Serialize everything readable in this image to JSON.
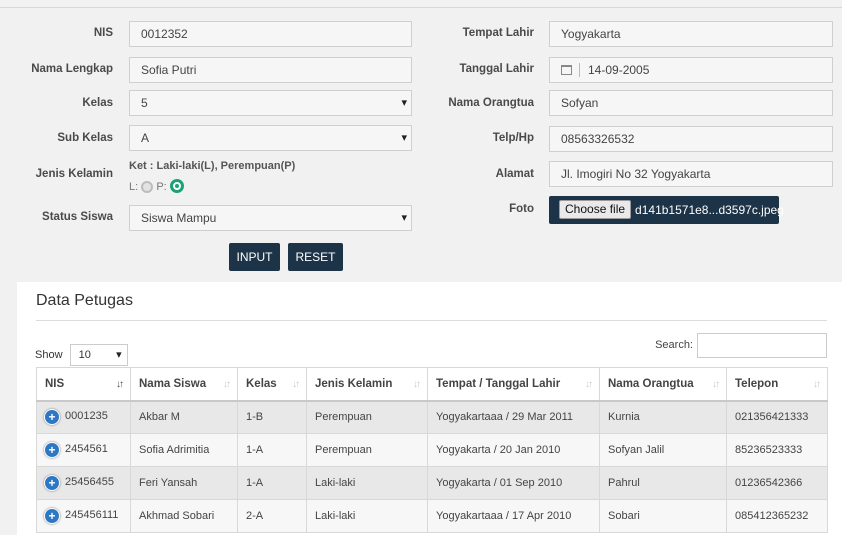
{
  "form": {
    "nis": {
      "label": "NIS",
      "value": "0012352"
    },
    "nama": {
      "label": "Nama Lengkap",
      "value": "Sofia Putri"
    },
    "kelas": {
      "label": "Kelas",
      "value": "5"
    },
    "subkelas": {
      "label": "Sub Kelas",
      "value": "A"
    },
    "jenis": {
      "label": "Jenis Kelamin",
      "note": "Ket : Laki-laki(L), Perempuan(P)",
      "opt_l": "L:",
      "opt_p": "P:",
      "selected": "P"
    },
    "status": {
      "label": "Status Siswa",
      "value": "Siswa Mampu"
    },
    "tempat": {
      "label": "Tempat Lahir",
      "value": "Yogyakarta"
    },
    "tanggal": {
      "label": "Tanggal Lahir",
      "value": "14-09-2005"
    },
    "orangtua": {
      "label": "Nama Orangtua",
      "value": "Sofyan"
    },
    "telp": {
      "label": "Telp/Hp",
      "value": "08563326532"
    },
    "alamat": {
      "label": "Alamat",
      "value": "Jl. Imogiri No 32 Yogyakarta"
    },
    "foto": {
      "label": "Foto",
      "button": "Choose file",
      "filename": "d141b1571e8...d3597c.jpeg"
    },
    "input_label": "INPUT",
    "reset_label": "RESET"
  },
  "table_panel": {
    "title": "Data Petugas",
    "show_label": "Show",
    "show_value": "10",
    "search_label": "Search:",
    "columns": [
      "NIS",
      "Nama Siswa",
      "Kelas",
      "Jenis Kelamin",
      "Tempat / Tanggal Lahir",
      "Nama Orangtua",
      "Telepon"
    ],
    "rows": [
      {
        "nis": "0001235",
        "nama": "Akbar M",
        "kelas": "1-B",
        "jk": "Perempuan",
        "ttl": "Yogyakartaaa / 29 Mar 2011",
        "ortu": "Kurnia",
        "telp": "021356421333"
      },
      {
        "nis": "2454561",
        "nama": "Sofia Adrimitia",
        "kelas": "1-A",
        "jk": "Perempuan",
        "ttl": "Yogyakarta / 20 Jan 2010",
        "ortu": "Sofyan Jalil",
        "telp": "85236523333"
      },
      {
        "nis": "25456455",
        "nama": "Feri Yansah",
        "kelas": "1-A",
        "jk": "Laki-laki",
        "ttl": "Yogyakarta / 01 Sep 2010",
        "ortu": "Pahrul",
        "telp": "01236542366"
      },
      {
        "nis": "245456111",
        "nama": "Akhmad Sobari",
        "kelas": "2-A",
        "jk": "Laki-laki",
        "ttl": "Yogyakartaaa / 17 Apr 2010",
        "ortu": "Sobari",
        "telp": "085412365232"
      }
    ]
  },
  "icons": {
    "calendar": "calendar-icon",
    "expand": "plus-circle-icon",
    "sort": "sort-icon",
    "dropdown": "chevron-down-icon"
  },
  "colors": {
    "accent": "#1d3347",
    "radio_selected": "#1aa374",
    "expand_icon": "#2c78c4"
  }
}
